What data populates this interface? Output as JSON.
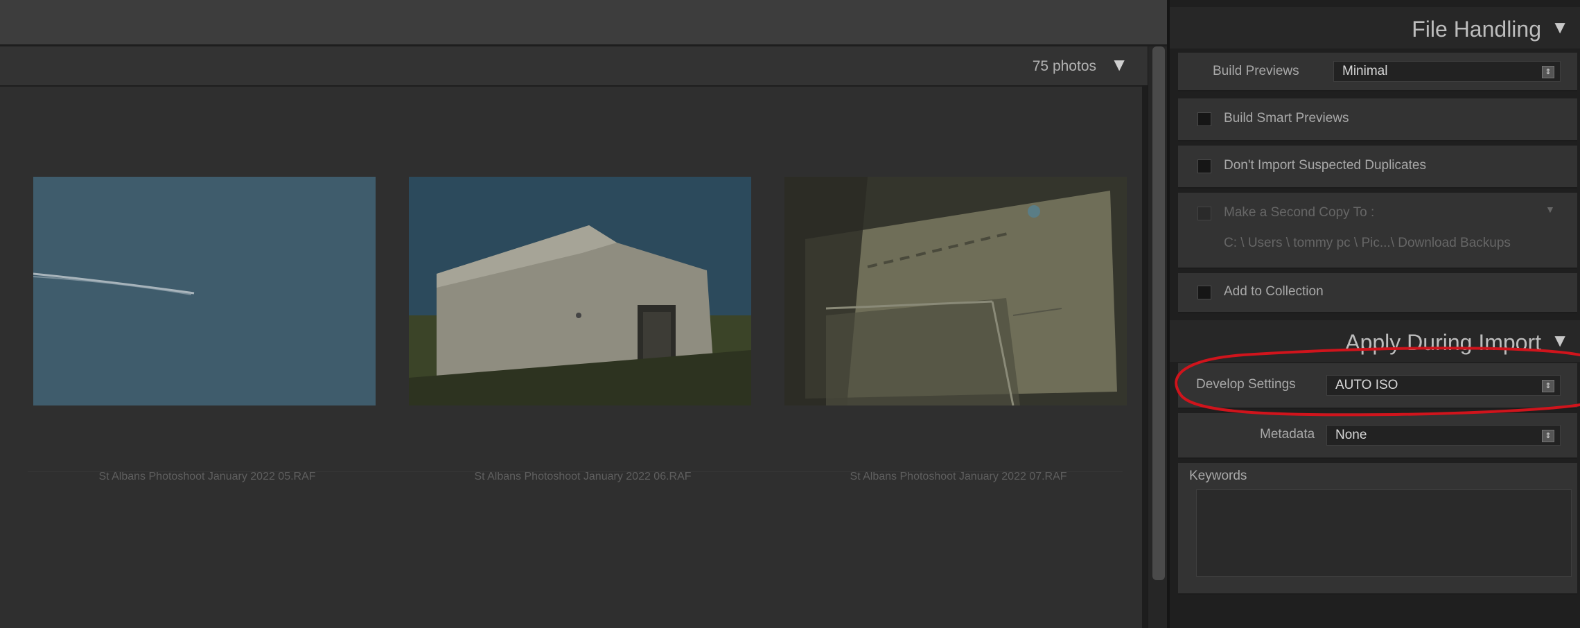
{
  "grid": {
    "photo_count": "75 photos",
    "photos": [
      {
        "filename": "St Albans Photoshoot January 2022 05.RAF",
        "thumb_icon": "sky-contrail-photo"
      },
      {
        "filename": "St Albans Photoshoot January 2022 06.RAF",
        "thumb_icon": "white-building-photo"
      },
      {
        "filename": "St Albans Photoshoot January 2022 07.RAF",
        "thumb_icon": "welcome-wall-photo"
      }
    ]
  },
  "file_handling": {
    "title": "File Handling",
    "build_previews_label": "Build Previews",
    "build_previews_value": "Minimal",
    "build_smart_previews": "Build Smart Previews",
    "dont_import_duplicates": "Don't Import Suspected Duplicates",
    "second_copy_label": "Make a Second Copy To :",
    "second_copy_path": "C: \\ Users \\ tommy pc \\ Pic...\\ Download Backups",
    "add_to_collection": "Add to Collection"
  },
  "apply_during_import": {
    "title": "Apply During Import",
    "develop_label": "Develop Settings",
    "develop_value": "AUTO ISO",
    "metadata_label": "Metadata",
    "metadata_value": "None",
    "keywords_label": "Keywords"
  },
  "colors": {
    "annotation": "#d0141c",
    "accent_text": "#d8d8d8"
  }
}
